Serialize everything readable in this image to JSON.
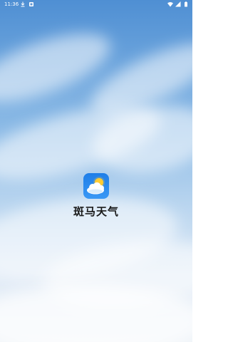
{
  "status_bar": {
    "time": "11:36",
    "left_icons": [
      "download-icon",
      "notification-icon"
    ],
    "right_icons": [
      "wifi-icon",
      "signal-icon",
      "battery-icon"
    ]
  },
  "splash": {
    "app_name": "斑马天气",
    "app_icon": "weather-sun-cloud-icon"
  },
  "colors": {
    "sky_top": "#4f8fd3",
    "sky_bottom": "#eef3f8",
    "icon_blue": "#1e7ee8",
    "sun": "#ffcc33",
    "text": "#1a1a1a"
  }
}
